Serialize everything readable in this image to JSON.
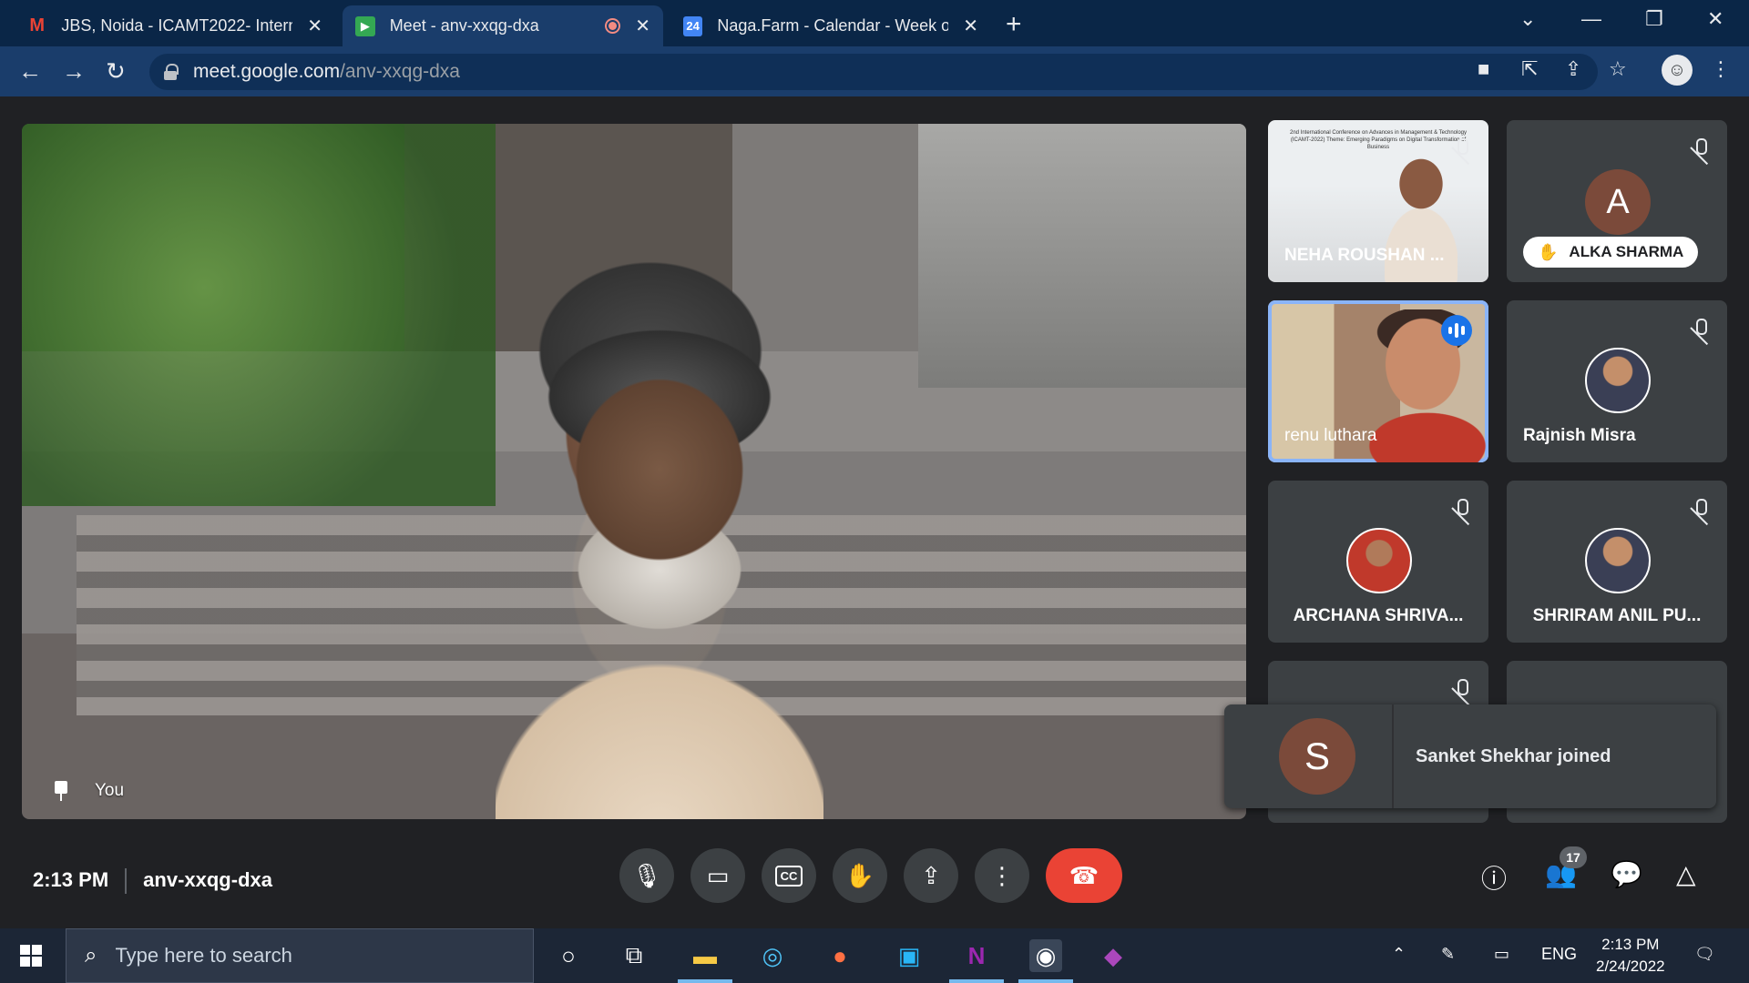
{
  "browser": {
    "tabs": [
      {
        "title": "JBS, Noida - ICAMT2022- Interna",
        "favicon": "gmail-icon"
      },
      {
        "title": "Meet - anv-xxqg-dxa",
        "favicon": "meet-icon",
        "recording": true
      },
      {
        "title": "Naga.Farm - Calendar - Week of",
        "favicon": "calendar-icon",
        "favicon_text": "24"
      }
    ],
    "url_host": "meet.google.com",
    "url_path": "/anv-xxqg-dxa"
  },
  "meet": {
    "self_label": "You",
    "participants": [
      {
        "name": "NEHA ROUSHAN ...",
        "muted": true,
        "slide_text": "2nd International Conference on Advances in Management & Technology (ICAMT-2022) Theme: Emerging Paradigms on Digital Transformation of Business"
      },
      {
        "name": "ALKA SHARMA",
        "initial": "A",
        "hand_raised": true,
        "muted": true
      },
      {
        "name": "renu luthara",
        "speaking": true
      },
      {
        "name": "Rajnish Misra",
        "muted": true
      },
      {
        "name": "ARCHANA SHRIVA...",
        "muted": true
      },
      {
        "name": "SHRIRAM ANIL PU...",
        "muted": true
      }
    ],
    "toast": {
      "initial": "S",
      "message": "Sanket Shekhar joined"
    },
    "time": "2:13 PM",
    "meeting_code": "anv-xxqg-dxa",
    "participant_count": "17",
    "captions_label": "CC"
  },
  "taskbar": {
    "search_placeholder": "Type here to search",
    "language": "ENG",
    "time": "2:13 PM",
    "date": "2/24/2022"
  },
  "colors": {
    "accent_blue": "#1a73e8",
    "end_call_red": "#ea4335",
    "speaking_outline": "#8ab4f8"
  }
}
